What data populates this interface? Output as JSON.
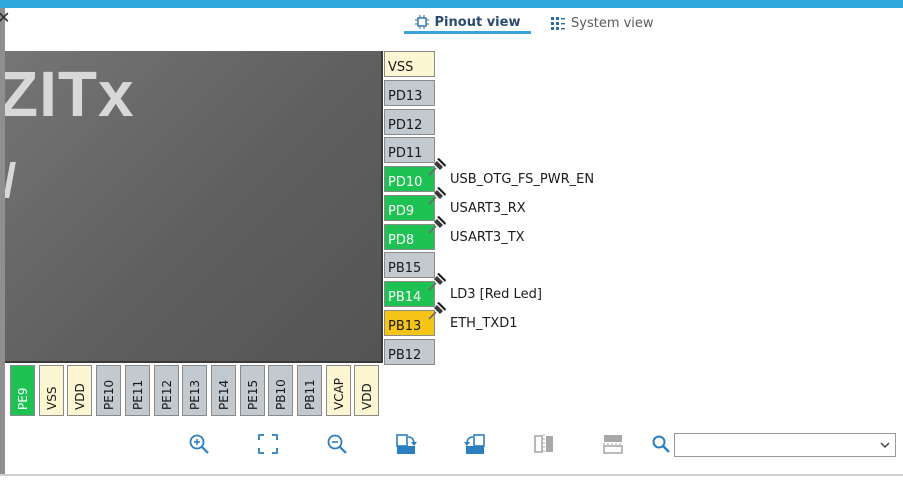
{
  "tabs": {
    "pinout": {
      "label": "Pinout view"
    },
    "system": {
      "label": "System view"
    }
  },
  "chip": {
    "name_fragment": "ZITx",
    "name_fragment2": "/"
  },
  "right_pins": [
    {
      "name": "VSS",
      "color": "vss"
    },
    {
      "name": "PD13",
      "color": "gray"
    },
    {
      "name": "PD12",
      "color": "gray"
    },
    {
      "name": "PD11",
      "color": "gray"
    },
    {
      "name": "PD10",
      "color": "green",
      "label": "USB_OTG_FS_PWR_EN",
      "pinned": true
    },
    {
      "name": "PD9",
      "color": "green",
      "label": "USART3_RX",
      "pinned": true
    },
    {
      "name": "PD8",
      "color": "green",
      "label": "USART3_TX",
      "pinned": true
    },
    {
      "name": "PB15",
      "color": "gray"
    },
    {
      "name": "PB14",
      "color": "green",
      "label": "LD3 [Red Led]",
      "pinned": true
    },
    {
      "name": "PB13",
      "color": "yellow",
      "label": "ETH_TXD1",
      "pinned": true
    },
    {
      "name": "PB12",
      "color": "gray"
    }
  ],
  "bottom_pins": [
    {
      "name": "PE9",
      "color": "green"
    },
    {
      "name": "VSS",
      "color": "vss"
    },
    {
      "name": "VDD",
      "color": "vss"
    },
    {
      "name": "PE10",
      "color": "gray"
    },
    {
      "name": "PE11",
      "color": "gray"
    },
    {
      "name": "PE12",
      "color": "gray"
    },
    {
      "name": "PE13",
      "color": "gray"
    },
    {
      "name": "PE14",
      "color": "gray"
    },
    {
      "name": "PE15",
      "color": "gray"
    },
    {
      "name": "PB10",
      "color": "gray"
    },
    {
      "name": "PB11",
      "color": "gray"
    },
    {
      "name": "VCAP",
      "color": "vss"
    },
    {
      "name": "VDD",
      "color": "vss"
    }
  ],
  "toolbar": {
    "icons": [
      "zoom-in-icon",
      "fit-screen-icon",
      "zoom-out-icon",
      "rotate-right-icon",
      "rotate-left-icon",
      "flip-vertical-icon",
      "flip-horizontal-icon",
      "search-icon"
    ],
    "search_value": ""
  },
  "colors": {
    "accent": "#2ea6de",
    "pin_green": "#1ec252",
    "pin_gray": "#c2c9cf",
    "pin_yellow": "#f5c518",
    "pin_power": "#fdf6d3",
    "chip_body": "#646464"
  }
}
